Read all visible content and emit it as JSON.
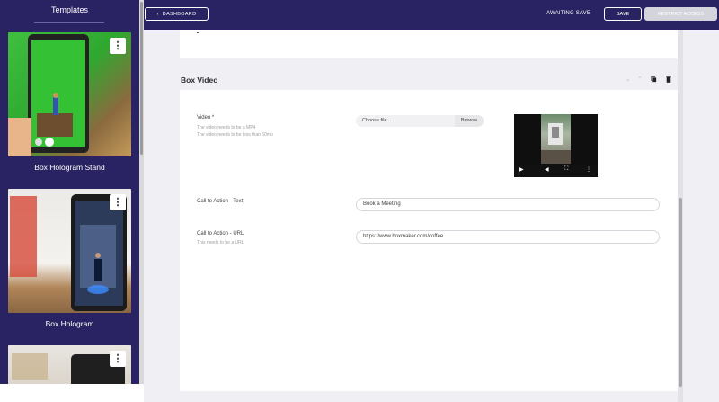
{
  "sidebar": {
    "title": "Templates",
    "templates": [
      {
        "label": "Box Hologram Stand",
        "menu": "⋮"
      },
      {
        "label": "Box Hologram",
        "menu": "⋮"
      },
      {
        "label": "",
        "menu": "⋮"
      }
    ]
  },
  "topbar": {
    "dashboard_label": "DASHBOARD",
    "status": "AWAITING SAVE",
    "save_label": "SAVE",
    "restrict_label": "RESTRICT ACCESS"
  },
  "section": {
    "title": "Box Video",
    "video": {
      "label": "Video *",
      "help": [
        "The video needs to be a MP4",
        "The video needs to be less than 50mb"
      ],
      "choose_label": "Choose file...",
      "browse_label": "Browse"
    },
    "cta_text": {
      "label": "Call to Action - Text",
      "value": "Book a Meeting"
    },
    "cta_url": {
      "label": "Call to Action - URL",
      "help": "This needs to be a URL",
      "value": "https://www.boxmaker.com/coffee"
    }
  },
  "colors": {
    "brand": "#2a2363",
    "panel": "#ffffff",
    "background": "#f0eff4"
  }
}
